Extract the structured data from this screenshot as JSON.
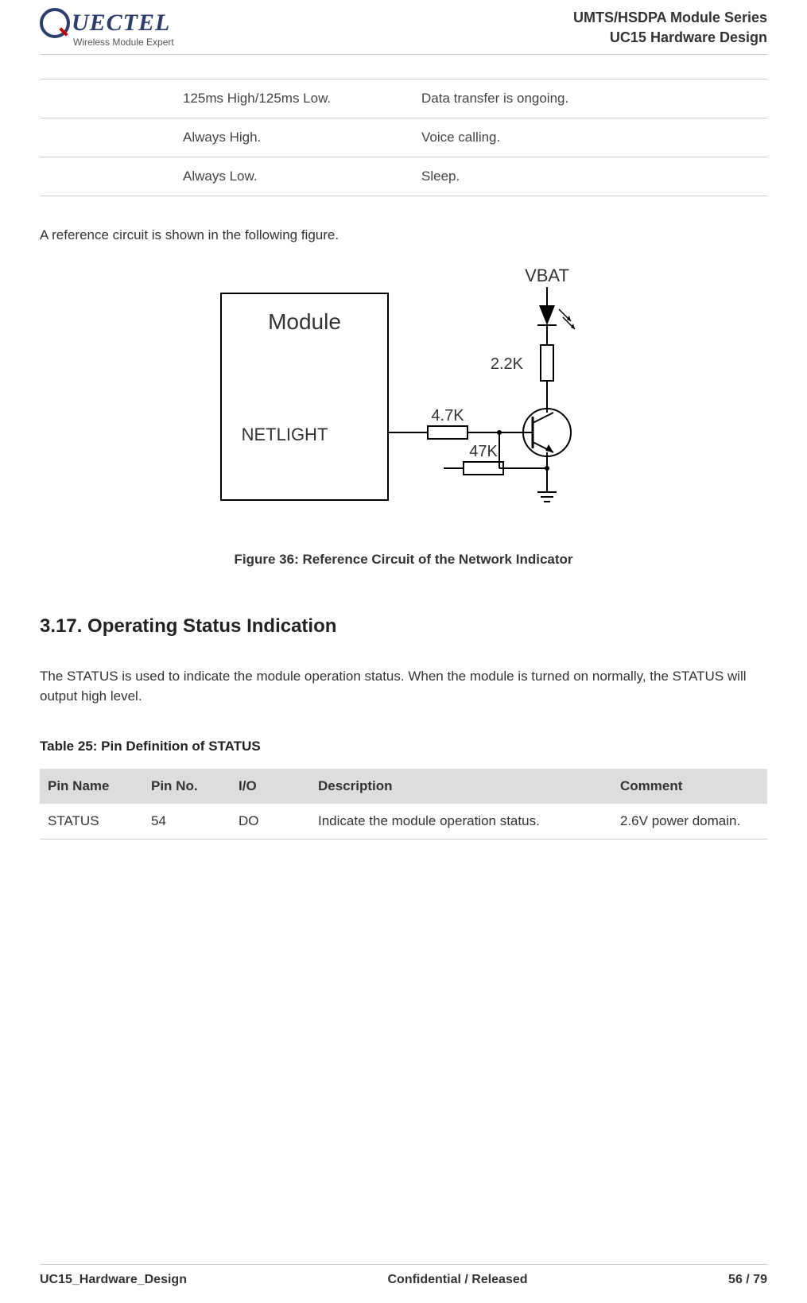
{
  "header": {
    "logo_text": "UECTEL",
    "logo_sub": "Wireless Module Expert",
    "line1": "UMTS/HSDPA Module Series",
    "line2": "UC15 Hardware Design"
  },
  "status_rows": [
    {
      "mid": "125ms High/125ms Low.",
      "right": "Data transfer is ongoing."
    },
    {
      "mid": "Always High.",
      "right": "Voice calling."
    },
    {
      "mid": "Always Low.",
      "right": "Sleep."
    }
  ],
  "ref_text": "A reference circuit is shown in the following figure.",
  "figure": {
    "module_label": "Module",
    "netlight": "NETLIGHT",
    "vbat": "VBAT",
    "r1": "4.7K",
    "r2": "47K",
    "r3": "2.2K",
    "caption": "Figure 36: Reference Circuit of the Network Indicator"
  },
  "section_heading": "3.17. Operating Status Indication",
  "section_body": "The STATUS is used to indicate the module operation status. When the module is turned on normally, the STATUS will output high level.",
  "table25": {
    "title": "Table 25: Pin Definition of STATUS",
    "headers": {
      "c1": "Pin Name",
      "c2": "Pin No.",
      "c3": "I/O",
      "c4": "Description",
      "c5": "Comment"
    },
    "row": {
      "c1": "STATUS",
      "c2": "54",
      "c3": "DO",
      "c4": "Indicate the module operation status.",
      "c5": "2.6V power domain."
    }
  },
  "footer": {
    "left": "UC15_Hardware_Design",
    "center": "Confidential / Released",
    "right": "56 / 79"
  }
}
